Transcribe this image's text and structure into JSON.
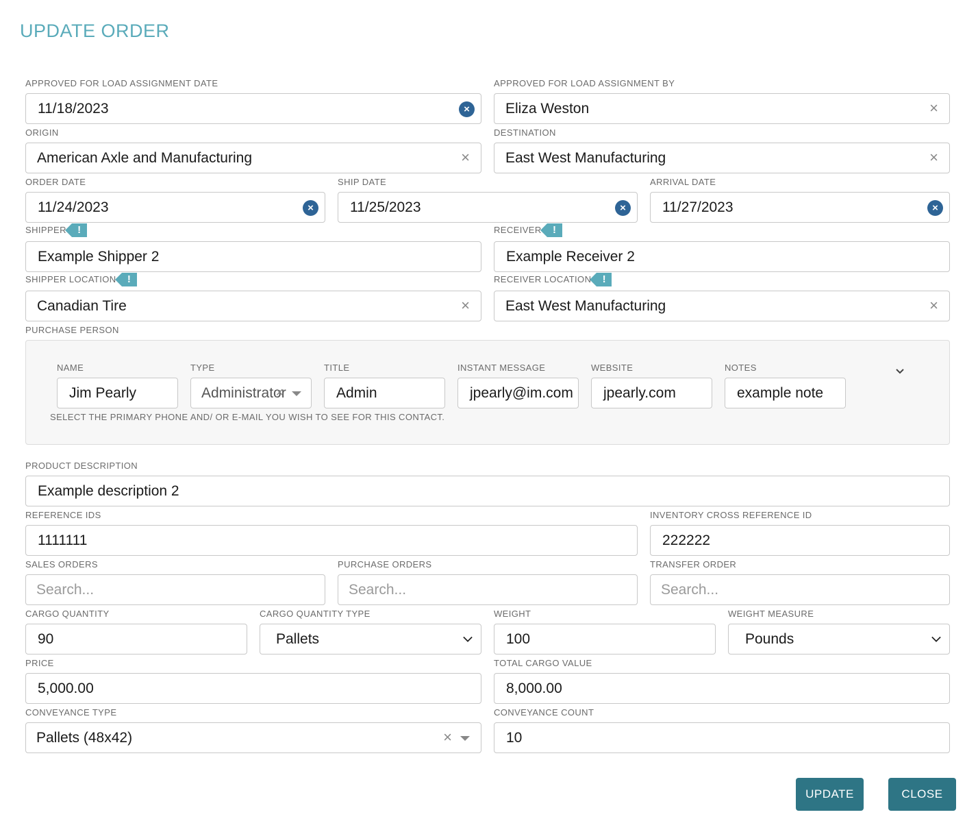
{
  "dialog": {
    "title": "UPDATE ORDER"
  },
  "approved_date": {
    "label": "APPROVED FOR LOAD ASSIGNMENT DATE",
    "value": "11/18/2023"
  },
  "approved_by": {
    "label": "APPROVED FOR LOAD ASSIGNMENT BY",
    "value": "Eliza Weston"
  },
  "origin": {
    "label": "ORIGIN",
    "value": "American Axle and Manufacturing"
  },
  "destination": {
    "label": "DESTINATION",
    "value": "East West Manufacturing"
  },
  "order_date": {
    "label": "ORDER DATE",
    "value": "11/24/2023"
  },
  "ship_date": {
    "label": "SHIP DATE",
    "value": "11/25/2023"
  },
  "arrival_date": {
    "label": "ARRIVAL DATE",
    "value": "11/27/2023"
  },
  "shipper": {
    "label": "SHIPPER",
    "value": "Example Shipper 2"
  },
  "receiver": {
    "label": "RECEIVER",
    "value": "Example Receiver 2"
  },
  "shipper_location": {
    "label": "SHIPPER LOCATION",
    "value": "Canadian Tire"
  },
  "receiver_location": {
    "label": "RECEIVER LOCATION",
    "value": "East West Manufacturing"
  },
  "purchase_person": {
    "label": "PURCHASE PERSON",
    "name": {
      "label": "NAME",
      "value": "Jim Pearly"
    },
    "type": {
      "label": "TYPE",
      "value": "Administrator"
    },
    "title": {
      "label": "TITLE",
      "value": "Admin"
    },
    "instant_message": {
      "label": "INSTANT MESSAGE",
      "value": "jpearly@im.com"
    },
    "website": {
      "label": "WEBSITE",
      "value": "jpearly.com"
    },
    "notes": {
      "label": "NOTES",
      "value": "example note"
    },
    "hint": "SELECT THE PRIMARY PHONE AND/ OR E-MAIL YOU WISH TO SEE FOR THIS CONTACT."
  },
  "product_description": {
    "label": "PRODUCT DESCRIPTION",
    "value": "Example description 2"
  },
  "reference_ids": {
    "label": "REFERENCE IDS",
    "value": "1111111"
  },
  "inventory_cross_ref": {
    "label": "INVENTORY CROSS REFERENCE ID",
    "value": "222222"
  },
  "sales_orders": {
    "label": "SALES ORDERS",
    "placeholder": "Search..."
  },
  "purchase_orders": {
    "label": "PURCHASE ORDERS",
    "placeholder": "Search..."
  },
  "transfer_order": {
    "label": "TRANSFER ORDER",
    "placeholder": "Search..."
  },
  "cargo_quantity": {
    "label": "CARGO QUANTITY",
    "value": "90"
  },
  "cargo_quantity_type": {
    "label": "CARGO QUANTITY TYPE",
    "value": "Pallets"
  },
  "weight": {
    "label": "WEIGHT",
    "value": "100"
  },
  "weight_measure": {
    "label": "WEIGHT MEASURE",
    "value": "Pounds"
  },
  "price": {
    "label": "PRICE",
    "value": "5,000.00"
  },
  "total_cargo_value": {
    "label": "TOTAL CARGO VALUE",
    "value": "8,000.00"
  },
  "conveyance_type": {
    "label": "CONVEYANCE TYPE",
    "value": "Pallets (48x42)"
  },
  "conveyance_count": {
    "label": "CONVEYANCE COUNT",
    "value": "10"
  },
  "buttons": {
    "update": "UPDATE",
    "close": "CLOSE"
  },
  "colors": {
    "accent": "#5aabba",
    "button": "#2e7585",
    "clear_circle": "#2e6496"
  },
  "glyphs": {
    "warning": "!",
    "clear": "×",
    "clear_circle": "×"
  }
}
